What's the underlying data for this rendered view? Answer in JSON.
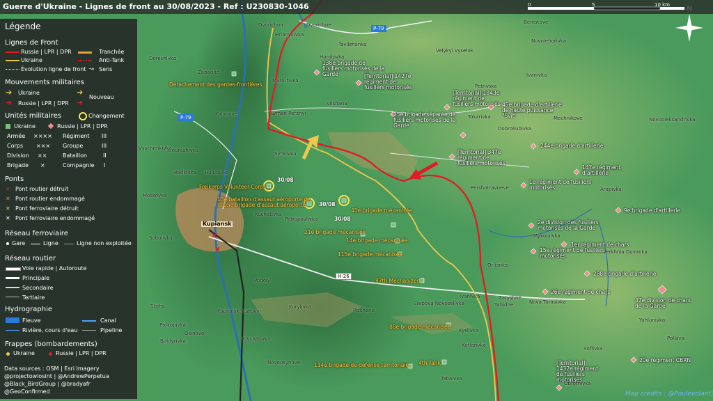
{
  "title": "Guerre d'Ukraine - Lignes de front au 30/08/2023 - Ref : U230830-1046",
  "scale": {
    "ticks": [
      "0",
      "5",
      "10 km"
    ]
  },
  "compass": "N",
  "legend": {
    "title": "Légende",
    "front": {
      "heading": "Lignes de Front",
      "russia": "Russie | LPR | DPR",
      "ukraine": "Ukraine",
      "evolution": "Évolution ligne de front",
      "trench": "Tranchée",
      "antitank": "Anti-Tank",
      "sens": "Sens"
    },
    "movements": {
      "heading": "Mouvements militaires",
      "ukraine": "Ukraine",
      "russia": "Russie | LPR | DPR",
      "nouveau": "Nouveau"
    },
    "units": {
      "heading": "Unités militaires",
      "change": "Changement",
      "ukraine": "Ukraine",
      "russia": "Russie | LPR | DPR",
      "rows": [
        [
          "Armée",
          "××××",
          "Régiment",
          "III"
        ],
        [
          "Corps",
          "×××",
          "Groupe",
          "III"
        ],
        [
          "Division",
          "××",
          "Bataillon",
          "II"
        ],
        [
          "Brigade",
          "×",
          "Compagnie",
          "I"
        ]
      ]
    },
    "bridges": {
      "heading": "Ponts",
      "items": [
        "Pont routier détruit",
        "Pont routier endommagé",
        "Pont ferroviaire détruit",
        "Pont ferroviaire endommagé"
      ]
    },
    "rail": {
      "heading": "Réseau ferroviaire",
      "gare": "Gare",
      "ligne": "Ligne",
      "unused": "Ligne non exploitée"
    },
    "roads": {
      "heading": "Réseau routier",
      "items": [
        "Voie rapide | Autoroute",
        "Principale",
        "Secondaire",
        "Tertiaire"
      ]
    },
    "hydro": {
      "heading": "Hydrographie",
      "fleuve": "Fleuve",
      "canal": "Canal",
      "riviere": "Rivière, cours d'eau",
      "pipeline": "Pipeline"
    },
    "strikes": {
      "heading": "Frappes (bombardements)",
      "ukraine": "Ukraine",
      "russia": "Russie | LPR | DPR"
    },
    "sources": [
      "Data sources : OSM | Esri Imagery",
      "@projectowlosint | @AndrewPerpetua",
      "@Black_BirdGroup | @bradyafr",
      "@GeoConfirmed"
    ]
  },
  "roads": [
    "P-79",
    "P-79",
    "H-26"
  ],
  "places": [
    "Dvorichna",
    "Dvorichne",
    "Hrianykivka",
    "Tavilzhanka",
    "Berestove",
    "Novoiehorivka",
    "Velykyi Vysełok",
    "Doroshivka",
    "Horobivka",
    "Masiutivka",
    "Zapadne",
    "Petrivske",
    "Ivanivka",
    "Vilshana",
    "Lyman Pershyi",
    "Kalynove",
    "Tokarivka",
    "Mechnikove",
    "Novooleksandrivka",
    "Dobroliubivka",
    "Synkivka",
    "Kindrashivka",
    "Radkivka",
    "Holubivka",
    "Kuchetivka",
    "Petropavlivka",
    "Pershotravneve",
    "Arapivka",
    "Moskovka",
    "Kupiansk",
    "Sobolivka",
    "Mykolaivka",
    "Verkhnia Duvanka",
    "Podoly",
    "Orlianka",
    "Zatyshne",
    "Yahidne",
    "Nova Tarasivka",
    "Stepova Novoselivka",
    "Pischane",
    "Ivanivka",
    "Kurylivka",
    "Kupiansk-Vuzlovyi",
    "Prokopivka",
    "Osinovo",
    "Boldyrivka",
    "Kivsharivka",
    "Kyslivka",
    "Kotlarivka",
    "Soflivka",
    "Novoosynove",
    "Tabaivka",
    "Yahlunivka",
    "Pollava",
    "Obrotnivka",
    "Striha",
    "Vyschenkivka"
  ],
  "russian_units": [
    "138e brigade de fusiliers motorisés de la Garde",
    "[Territorial] 1427e régiment de fusiliers motorisés",
    "[Territorial] 1843e régiment de fusiliers motorisés",
    "45e brigade d'artillerie de haute puissance \"Svit\"",
    "25e brigade séparée de fusiliers motorisés de la Garde",
    "244e brigade d'artillerie",
    "[Territorial] 347e régiment de fusiliers motorisés",
    "147e régiment d'artillerie",
    "1e régiment de fusiliers motorisés",
    "9e brigade d'artillerie",
    "2e division des fusiliers motorisés de la Garde",
    "1er régiment de chars",
    "15e régiment de fusiliers motorisés",
    "288e brigade d'artillerie",
    "26e régiment de chars",
    "47e division de chars de la Garde",
    "[Territorial] 1432e régiment de fusiliers motorisés",
    "20e régiment CBRN"
  ],
  "ukrainian_units": [
    "Détachement des gardes-frontières",
    "Freikorps Volunteer Corps",
    "13e bataillon d'assaut aéroporté de la 95e brigade d'assaut aéroporté",
    "41e brigade mécanisée",
    "21e brigade mécanisée",
    "14e brigade mécanisée",
    "115e brigade mécanisée",
    "87th Mechanized",
    "88e brigade mécanisée",
    "114e brigade de défense territoriale",
    "4th Tank"
  ],
  "dates": [
    "30/08",
    "30/08",
    "30/08"
  ],
  "credit": "Map credits : @Poulevolant3",
  "colors": {
    "russia": "#e01b24",
    "ukraine": "#f2c84b",
    "terrain": "#3f8a55"
  }
}
